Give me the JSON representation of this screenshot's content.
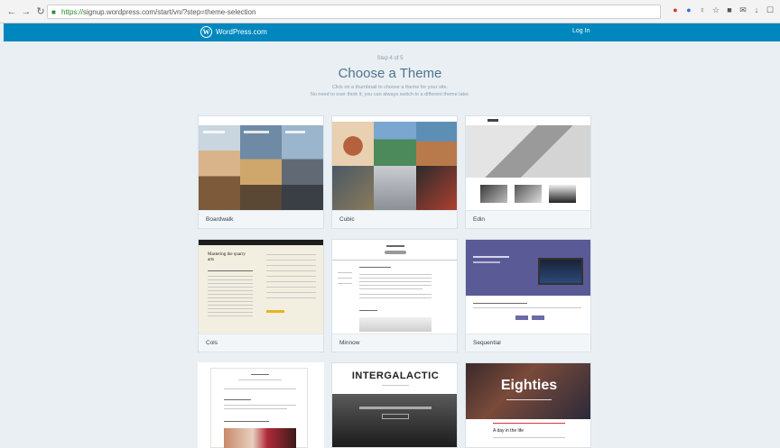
{
  "browser": {
    "url_https": "https://",
    "url_rest": "signup.wordpress.com/start/vn/?step=theme-selection"
  },
  "masthead": {
    "brand": "WordPress.com",
    "login_label": "Log In",
    "accent": "#0087be"
  },
  "header": {
    "step": "Step 4 of 5",
    "title": "Choose a Theme",
    "subtitle_line1": "Click on a thumbnail to choose a theme for your site.",
    "subtitle_line2": "No need to over think it; you can always switch to a different theme later."
  },
  "themes": [
    {
      "name": "Boardwalk"
    },
    {
      "name": "Cubic"
    },
    {
      "name": "Edin"
    },
    {
      "name": "Cols"
    },
    {
      "name": "Minnow"
    },
    {
      "name": "Sequential"
    },
    {
      "name": ""
    },
    {
      "name": ""
    },
    {
      "name": ""
    }
  ],
  "theme_thumb_text": {
    "intergalactic": "INTERGALACTIC",
    "eighties": "Eighties",
    "eighties_sub": "A day in the life",
    "cols_heading": "Mastering the quarry arts"
  }
}
